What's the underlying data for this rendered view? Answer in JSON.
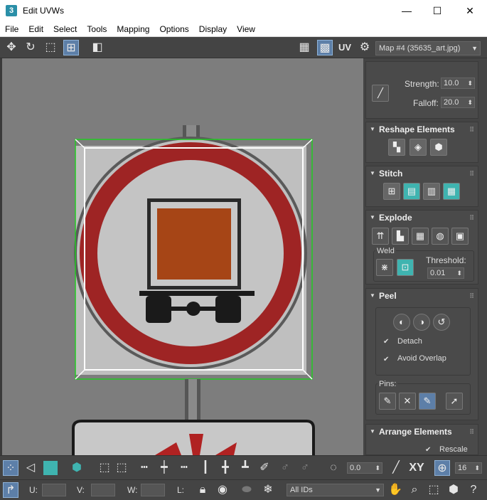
{
  "window": {
    "title": "Edit UVWs",
    "app_icon": "3",
    "minimize": "—",
    "maximize": "☐",
    "close": "✕"
  },
  "menu": [
    "File",
    "Edit",
    "Select",
    "Tools",
    "Mapping",
    "Options",
    "Display",
    "View"
  ],
  "toolbar": {
    "uv_label": "UV",
    "map_select": "Map #4 (35635_art.jpg)"
  },
  "panel": {
    "strength_label": "Strength:",
    "strength_value": "10.0",
    "falloff_label": "Falloff:",
    "falloff_value": "20.0",
    "reshape_title": "Reshape Elements",
    "stitch_title": "Stitch",
    "explode_title": "Explode",
    "weld_label": "Weld",
    "threshold_label": "Threshold:",
    "threshold_value": "0.01",
    "peel_title": "Peel",
    "detach_label": "Detach",
    "avoid_overlap_label": "Avoid Overlap",
    "pins_label": "Pins:",
    "arrange_title": "Arrange Elements",
    "rescale_label": "Rescale"
  },
  "bottom": {
    "spinner_value": "0.0",
    "xy_label": "XY",
    "grid_value": "16",
    "u_label": "U:",
    "v_label": "V:",
    "w_label": "W:",
    "l_label": "L:",
    "ids_select": "All IDs"
  },
  "colors": {
    "accent": "#5d7fa8",
    "teal": "#3fb4b0",
    "uv_green": "#22cc22",
    "sign_red": "#c02a2a",
    "cargo": "#b0470f"
  }
}
